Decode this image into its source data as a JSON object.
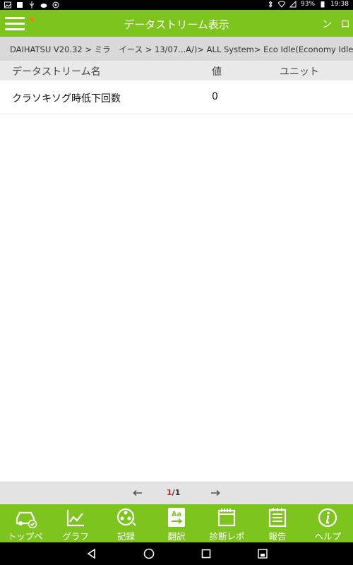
{
  "status_bar": {
    "battery": "93%",
    "time": "19:38"
  },
  "header": {
    "title": "データストリーム表示",
    "action_1": "ン",
    "action_2": "ロ"
  },
  "breadcrumb": "DAIHATSU V20.32 > ミラ　イース > 13/07...A/)> ALL System> Eco Idle(Economy Idle)",
  "table": {
    "columns": [
      "データストリーム名",
      "値",
      "ユニット"
    ],
    "rows": [
      {
        "name": "クラソキソグ時低下回数",
        "value": "0",
        "unit": ""
      }
    ]
  },
  "pager": {
    "current": "1",
    "separator": "/",
    "total": "1"
  },
  "toolbar": {
    "items": [
      {
        "label": "トップペ",
        "icon": "car-check-icon"
      },
      {
        "label": "グラフ",
        "icon": "graph-icon"
      },
      {
        "label": "記録",
        "icon": "record-reel-icon"
      },
      {
        "label": "翻訳",
        "icon": "translate-icon"
      },
      {
        "label": "診断レポ",
        "icon": "report-calendar-icon"
      },
      {
        "label": "報告",
        "icon": "notes-icon"
      },
      {
        "label": "ヘルプ",
        "icon": "help-info-icon"
      }
    ]
  },
  "colors": {
    "accent": "#7dc51e",
    "notification_dot": "#ff7a1a",
    "page_current": "#d32020"
  }
}
